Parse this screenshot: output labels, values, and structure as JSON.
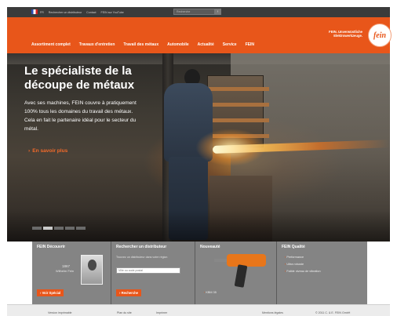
{
  "topbar": {
    "links": [
      "FR",
      "Rechercher un distributeur",
      "Contact",
      "FEIN sur YouTube"
    ],
    "search_placeholder": "Recherche",
    "search_button": "›"
  },
  "header": {
    "nav": [
      "Assortiment complet",
      "Travaux d'entretien",
      "Travail des métaux",
      "Automobile",
      "Actualité",
      "Service",
      "FEIN"
    ],
    "brand_tag_1": "FEIN. Unverwüstliche",
    "brand_tag_2": "Elektrowerkzeuge.",
    "logo": "fein"
  },
  "hero": {
    "title_line1": "Le spécialiste de la",
    "title_line2": "découpe de métaux",
    "text": "Avec ses machines, FEIN couvre à pratiquement 100% tous les domaines du travail des métaux. Cela en fait le partenaire idéal pour le secteur du métal.",
    "cta": "En savoir plus",
    "slides": 5,
    "active_slide": 2
  },
  "panels": {
    "p1": {
      "title": "FEIN Découvrir",
      "year": "1867",
      "name": "Wilhelm Fein",
      "button": "Voir Spécial"
    },
    "p2": {
      "title": "Rechercher un distributeur",
      "desc": "Trouvez un distributeur dans votre région",
      "field_placeholder": "Ville ou code postal",
      "button": "Recherche"
    },
    "p3": {
      "title": "Nouveauté",
      "label": "KBM 35"
    },
    "p4": {
      "title": "FEIN Qualité",
      "items": [
        "Performance",
        "Ultra robuste",
        "Faible niveau de vibration"
      ]
    }
  },
  "footer": {
    "links": [
      "Version imprimable",
      "Plan du site",
      "Imprimer"
    ],
    "legal": "Mentions légales",
    "copyright": "© 2011 C. & E. FEIN GmbH"
  },
  "colors": {
    "brand_orange": "#e8561a",
    "topbar": "#3b3b3b",
    "panel": "#6e6e6e"
  }
}
